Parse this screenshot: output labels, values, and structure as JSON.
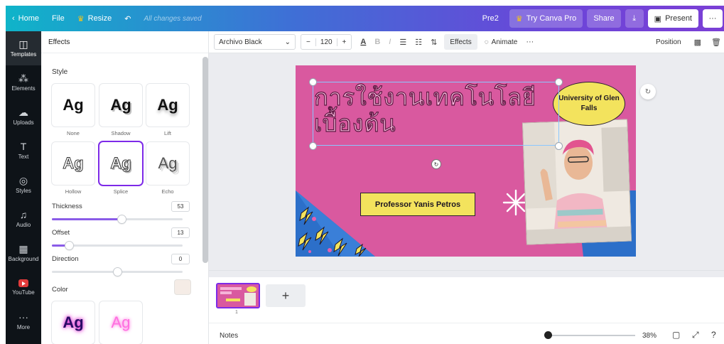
{
  "topbar": {
    "home": "Home",
    "file": "File",
    "resize": "Resize",
    "saved_status": "All changes saved",
    "doc_name": "Pre2",
    "try_pro": "Try Canva Pro",
    "share": "Share",
    "present": "Present",
    "more": "···"
  },
  "rail": {
    "items": [
      {
        "label": "Templates",
        "icon": "templates-icon"
      },
      {
        "label": "Elements",
        "icon": "elements-icon"
      },
      {
        "label": "Uploads",
        "icon": "uploads-icon"
      },
      {
        "label": "Text",
        "icon": "text-icon"
      },
      {
        "label": "Styles",
        "icon": "styles-icon"
      },
      {
        "label": "Audio",
        "icon": "audio-icon"
      },
      {
        "label": "Background",
        "icon": "background-icon"
      },
      {
        "label": "YouTube",
        "icon": "youtube-icon"
      },
      {
        "label": "More",
        "icon": "more-icon"
      }
    ]
  },
  "panel": {
    "title": "Effects",
    "style_heading": "Style",
    "tile_text": "Ag",
    "styles": [
      "None",
      "Shadow",
      "Lift",
      "Hollow",
      "Splice",
      "Echo"
    ],
    "selected_style": "Splice",
    "sliders": [
      {
        "label": "Thickness",
        "value": "53",
        "level": 0.53
      },
      {
        "label": "Offset",
        "value": "13",
        "level": 0.13
      },
      {
        "label": "Direction",
        "value": "0",
        "level": 0.5
      }
    ],
    "color_label": "Color",
    "color_value": "#f5ece6"
  },
  "toolbar": {
    "font": "Archivo Black",
    "size_minus": "−",
    "size": "120",
    "size_plus": "+",
    "text_color": "A",
    "bold": "B",
    "italic": "I",
    "effects": "Effects",
    "animate": "Animate",
    "more": "···",
    "position": "Position"
  },
  "slide": {
    "title": "การใช้งานเทคโนโลยีเบื้องต้น",
    "university": "University of Glen Falls",
    "professor": "Professor Yanis Petros",
    "background_color": "#d9599f",
    "accent_yellow": "#f3e35d"
  },
  "pages": {
    "current": "1",
    "add": "+"
  },
  "footer": {
    "notes": "Notes",
    "zoom": "38%",
    "zoom_level": 0.38
  }
}
